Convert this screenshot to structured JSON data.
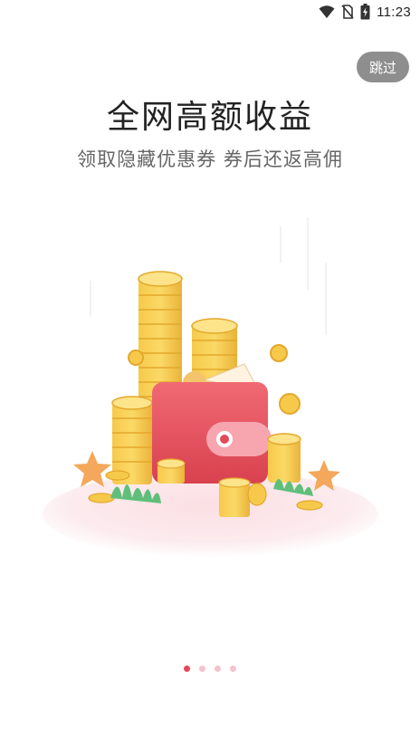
{
  "status_bar": {
    "time": "11:23",
    "icons": [
      "wifi-icon",
      "no-sim-icon",
      "battery-charging-icon"
    ]
  },
  "skip_button": {
    "label": "跳过"
  },
  "onboarding": {
    "title": "全网高额收益",
    "subtitle": "领取隐藏优惠券 券后还返高佣",
    "illustration_icons": [
      "wallet-icon",
      "coin-stack-icon",
      "star-icon",
      "grass-icon"
    ]
  },
  "pager": {
    "total": 4,
    "active_index": 0,
    "active_color": "#e8475b",
    "inactive_color": "#f3c4cb"
  }
}
